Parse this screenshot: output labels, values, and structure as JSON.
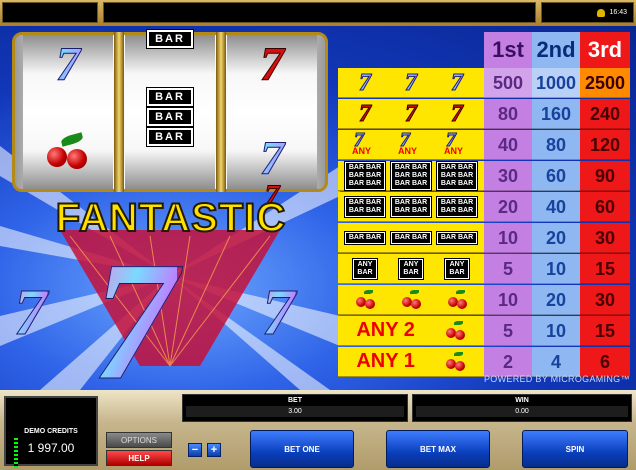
{
  "topbar": {
    "clock": "16:43",
    "bell_icon": "bell-icon"
  },
  "title": "FANTASTIC",
  "paytable": {
    "headers": [
      "1st",
      "2nd",
      "3rd"
    ],
    "rows": [
      {
        "combo": "rainbow-seven x3",
        "values": [
          "500",
          "1000",
          "2500"
        ]
      },
      {
        "combo": "red-seven x3",
        "values": [
          "80",
          "160",
          "240"
        ]
      },
      {
        "combo": "any-seven x3",
        "any_label": "ANY",
        "values": [
          "40",
          "80",
          "120"
        ]
      },
      {
        "combo": "triple-bar x3",
        "values": [
          "30",
          "60",
          "90"
        ]
      },
      {
        "combo": "double-bar x3",
        "values": [
          "20",
          "40",
          "60"
        ]
      },
      {
        "combo": "single-bar x3",
        "values": [
          "10",
          "20",
          "30"
        ]
      },
      {
        "combo": "any-bar x3",
        "any_label": "ANY",
        "bar_label": "BAR",
        "values": [
          "5",
          "10",
          "15"
        ]
      },
      {
        "combo": "cherry x3",
        "values": [
          "10",
          "20",
          "30"
        ]
      },
      {
        "combo": "any 2 cherry",
        "label": "ANY 2",
        "values": [
          "5",
          "10",
          "15"
        ]
      },
      {
        "combo": "any 1 cherry",
        "label": "ANY 1",
        "values": [
          "2",
          "4",
          "6"
        ]
      }
    ],
    "powered_by": "POWERED BY MICROGAMING™"
  },
  "reels": {
    "reel2_bar_label": "BAR"
  },
  "controls": {
    "credits_label": "DEMO CREDITS",
    "credits_value": "1 997.00",
    "options": "OPTIONS",
    "help": "HELP",
    "bet_label": "BET",
    "bet_value": "3.00",
    "win_label": "WIN",
    "win_value": "0.00",
    "minus": "−",
    "plus": "+",
    "bet_one": "BET ONE",
    "bet_max": "BET MAX",
    "spin": "SPIN"
  }
}
